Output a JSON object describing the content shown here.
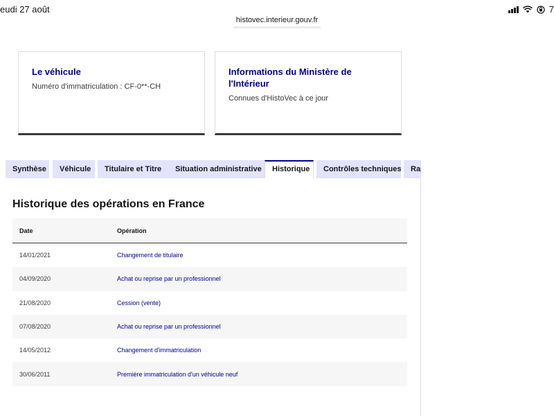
{
  "status_bar": {
    "date": "eudi 27 août",
    "battery_text": "7"
  },
  "browser": {
    "url": "histovec.interieur.gouv.fr"
  },
  "cards": [
    {
      "title": "Le véhicule",
      "text": "Numéro d'immatriculation : CF-0**-CH"
    },
    {
      "title": "Informations du Ministère de l'Intérieur",
      "text": "Connues d'HistoVec à ce jour"
    }
  ],
  "tabs": [
    {
      "label": "Synthèse",
      "active": false
    },
    {
      "label": "Véhicule",
      "active": false
    },
    {
      "label": "Titulaire et Titre",
      "active": false
    },
    {
      "label": "Situation administrative",
      "active": false
    },
    {
      "label": "Historique",
      "active": true
    },
    {
      "label": "Contrôles techniques",
      "active": false
    },
    {
      "label": "Rap",
      "active": false
    }
  ],
  "section": {
    "title": "Historique des opérations en France"
  },
  "table": {
    "headers": {
      "date": "Date",
      "operation": "Opération"
    },
    "rows": [
      {
        "date": "14/01/2021",
        "operation": "Changement de titulaire"
      },
      {
        "date": "04/09/2020",
        "operation": "Achat ou reprise par un professionnel"
      },
      {
        "date": "21/08/2020",
        "operation": "Cession (vente)"
      },
      {
        "date": "07/08/2020",
        "operation": "Achat ou reprise par un professionnel"
      },
      {
        "date": "14/05/2012",
        "operation": "Changement d'immatriculation"
      },
      {
        "date": "30/06/2011",
        "operation": "Première immatriculation d'un véhicule neuf"
      }
    ]
  },
  "colors": {
    "accent_blue": "#000091",
    "tab_bg": "#e3e3fd",
    "row_stripe": "#f6f6f6"
  }
}
